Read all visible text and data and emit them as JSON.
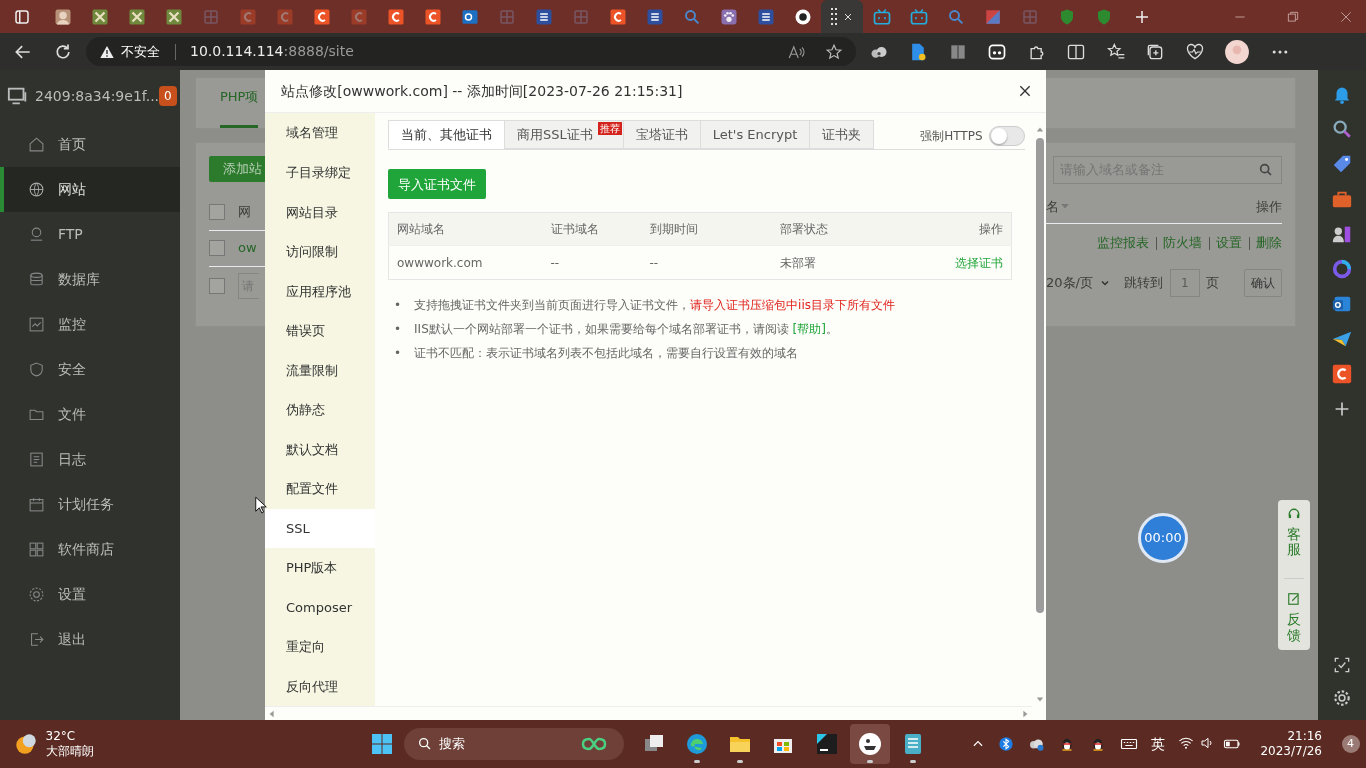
{
  "browser": {
    "tabs": [
      {
        "asleep": false,
        "selected": false
      },
      {
        "asleep": false,
        "selected": false
      },
      {
        "asleep": false,
        "selected": false
      },
      {
        "asleep": false,
        "selected": false
      },
      {
        "asleep": true,
        "selected": false
      },
      {
        "asleep": true,
        "selected": false
      },
      {
        "asleep": true,
        "selected": false
      },
      {
        "asleep": false,
        "selected": false
      },
      {
        "asleep": true,
        "selected": false
      },
      {
        "asleep": false,
        "selected": false
      },
      {
        "asleep": false,
        "selected": false
      },
      {
        "asleep": false,
        "selected": false
      },
      {
        "asleep": true,
        "selected": false
      },
      {
        "asleep": false,
        "selected": false
      },
      {
        "asleep": true,
        "selected": false
      },
      {
        "asleep": false,
        "selected": false
      },
      {
        "asleep": false,
        "selected": false
      },
      {
        "asleep": false,
        "selected": false
      },
      {
        "asleep": false,
        "selected": false
      },
      {
        "asleep": false,
        "selected": false
      },
      {
        "asleep": false,
        "selected": false
      },
      {
        "asleep": false,
        "selected": true
      },
      {
        "asleep": false,
        "selected": false
      },
      {
        "asleep": false,
        "selected": false
      },
      {
        "asleep": false,
        "selected": false
      },
      {
        "asleep": false,
        "selected": false
      },
      {
        "asleep": true,
        "selected": false
      },
      {
        "asleep": false,
        "selected": false
      },
      {
        "asleep": false,
        "selected": false
      }
    ],
    "address": {
      "warning": "不安全",
      "host": "10.0.114.114",
      "rest": ":8888/site"
    }
  },
  "app_sidebar": {
    "server": "2409:8a34:9e1f...",
    "badge": "0",
    "items": [
      {
        "label": "首页",
        "selected": false
      },
      {
        "label": "网站",
        "selected": true
      },
      {
        "label": "FTP",
        "selected": false
      },
      {
        "label": "数据库",
        "selected": false
      },
      {
        "label": "监控",
        "selected": false
      },
      {
        "label": "安全",
        "selected": false
      },
      {
        "label": "文件",
        "selected": false
      },
      {
        "label": "日志",
        "selected": false
      },
      {
        "label": "计划任务",
        "selected": false
      },
      {
        "label": "软件商店",
        "selected": false
      },
      {
        "label": "设置",
        "selected": false
      },
      {
        "label": "退出",
        "selected": false
      }
    ]
  },
  "page_left": {
    "tab": "PHP项",
    "add_button": "添加站",
    "header": "网",
    "row": "ow",
    "input_placeholder": "请",
    "checkboxes": [
      {
        "checked": false
      },
      {
        "checked": false
      },
      {
        "checked": false
      }
    ]
  },
  "page_right": {
    "search_placeholder": "请输入域名或备注",
    "header": "名",
    "actions_header": "操作",
    "actions": [
      "监控报表",
      "防火墙",
      "设置",
      "删除"
    ],
    "page_size": "20条/页",
    "goto": "跳转到",
    "page": "1",
    "page_unit": "页",
    "confirm": "确认"
  },
  "modal": {
    "title": "站点修改[owwwork.com] -- 添加时间[2023-07-26 21:15:31]",
    "nav": [
      {
        "label": "域名管理",
        "selected": false
      },
      {
        "label": "子目录绑定",
        "selected": false
      },
      {
        "label": "网站目录",
        "selected": false
      },
      {
        "label": "访问限制",
        "selected": false
      },
      {
        "label": "应用程序池",
        "selected": false
      },
      {
        "label": "错误页",
        "selected": false
      },
      {
        "label": "流量限制",
        "selected": false
      },
      {
        "label": "伪静态",
        "selected": false
      },
      {
        "label": "默认文档",
        "selected": false
      },
      {
        "label": "配置文件",
        "selected": false
      },
      {
        "label": "SSL",
        "selected": true
      },
      {
        "label": "PHP版本",
        "selected": false
      },
      {
        "label": "Composer",
        "selected": false
      },
      {
        "label": "重定向",
        "selected": false
      },
      {
        "label": "反向代理",
        "selected": false
      }
    ],
    "tabs": [
      {
        "label": "当前、其他证书",
        "selected": true
      },
      {
        "label": "商用SSL证书",
        "selected": false,
        "ribbon": "推荐"
      },
      {
        "label": "宝塔证书",
        "selected": false
      },
      {
        "label": "Let's Encrypt",
        "selected": false
      },
      {
        "label": "证书夹",
        "selected": false
      }
    ],
    "force_https": {
      "label": "强制HTTPS",
      "on": false
    },
    "import_button": "导入证书文件",
    "table": {
      "columns": [
        "网站域名",
        "证书域名",
        "到期时间",
        "部署状态",
        "操作"
      ],
      "rows": [
        [
          "owwwork.com",
          "--",
          "--",
          "未部署",
          "选择证书"
        ]
      ]
    },
    "notes": [
      {
        "bullet": "•",
        "text": "支持拖拽证书文件夹到当前页面进行导入证书文件，",
        "highlight": "请导入证书压缩包中iis目录下所有文件"
      },
      {
        "bullet": "•",
        "text": "IIS默认一个网站部署一个证书，如果需要给每个域名部署证书，请阅读 ",
        "link": "[帮助]",
        "after": "。"
      },
      {
        "bullet": "•",
        "text": "证书不匹配：表示证书域名列表不包括此域名，需要自行设置有效的域名"
      }
    ]
  },
  "widgets": {
    "timer": "00:00",
    "service": "客服",
    "feedback": "反馈"
  },
  "taskbar": {
    "weather": {
      "temp": "32°C",
      "desc": "大部晴朗"
    },
    "search": "搜索",
    "apps": [
      {
        "running": false,
        "selected": false
      },
      {
        "running": true,
        "selected": false
      },
      {
        "running": true,
        "selected": false
      },
      {
        "running": false,
        "selected": false
      },
      {
        "running": false,
        "selected": false
      },
      {
        "running": true,
        "selected": true
      },
      {
        "running": true,
        "selected": false
      }
    ],
    "tray": {
      "ime": "英",
      "time": "21:16",
      "date": "2023/7/26",
      "notifications": "4"
    }
  }
}
